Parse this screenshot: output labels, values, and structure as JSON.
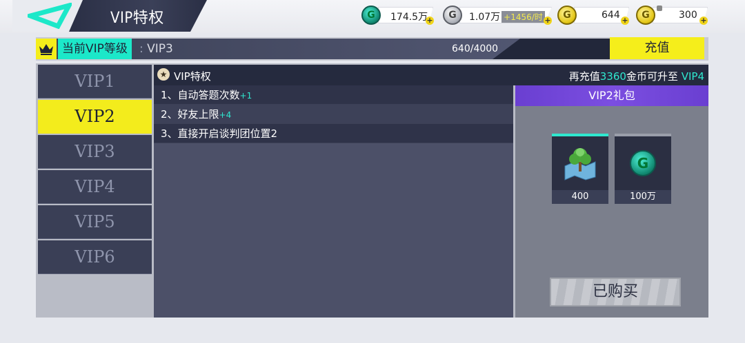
{
  "header": {
    "title": "VIP特权",
    "back_icon": "back-triangle-icon",
    "currencies": [
      {
        "name": "teal-coin",
        "value": "174.5万",
        "color": "#1fc8a8"
      },
      {
        "name": "silver-coin",
        "value": "1.07万",
        "rate": "+1456/时",
        "color": "#a9acb4"
      },
      {
        "name": "gold-coin",
        "value": "644",
        "color": "#e2c411"
      },
      {
        "name": "gold-coin-locked",
        "value": "300",
        "color": "#e2c411"
      }
    ]
  },
  "level_bar": {
    "label": "当前VIP等级",
    "separator": ":",
    "current_level": "VIP3",
    "progress": "640/4000",
    "recharge_label": "充值"
  },
  "sidebar": {
    "tabs": [
      "VIP1",
      "VIP2",
      "VIP3",
      "VIP4",
      "VIP5",
      "VIP6"
    ],
    "active_index": 1
  },
  "content": {
    "header_title": "VIP特权",
    "upgrade_prefix": "再充值",
    "upgrade_amount": "3360",
    "upgrade_mid": "金币可升至",
    "upgrade_target": "VIP4",
    "benefits": [
      {
        "text": "1、自动答题次数",
        "bonus": "+1"
      },
      {
        "text": "2、好友上限",
        "bonus": "+4"
      },
      {
        "text": "3、直接开启谈判团位置2",
        "bonus": ""
      }
    ]
  },
  "gift": {
    "title": "VIP2礼包",
    "items": [
      {
        "icon": "map-tree-icon",
        "count": "400"
      },
      {
        "icon": "teal-coin-icon",
        "count": "100万"
      }
    ],
    "button_label": "已购买"
  },
  "colors": {
    "accent_yellow": "#f3ec1c",
    "accent_cyan": "#2fe8cf",
    "panel_dark": "#3a3f56",
    "gift_purple": "#7b4ee0"
  }
}
